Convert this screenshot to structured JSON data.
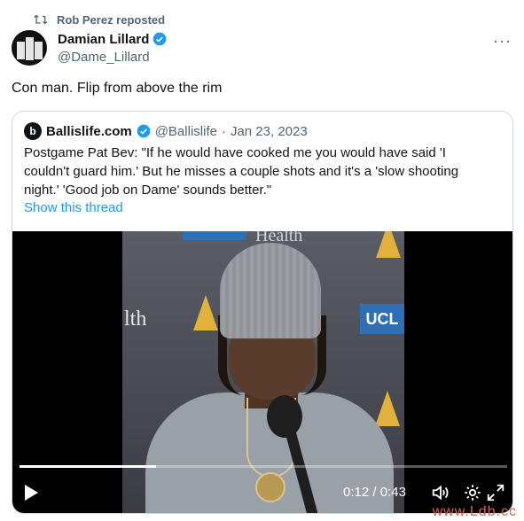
{
  "repost": {
    "icon": "repost-icon",
    "text": "Rob Perez reposted"
  },
  "author": {
    "name": "Damian Lillard",
    "handle": "@Dame_Lillard",
    "verified": true
  },
  "more_menu": {
    "label": "···",
    "icon": "more-icon"
  },
  "tweet": {
    "text": "Con man. Flip from above the rim"
  },
  "quote": {
    "logo": "b",
    "name": "Ballislife.com",
    "handle": "@Ballislife",
    "separator": "·",
    "date": "Jan 23, 2023",
    "text": "Postgame Pat Bev: \"If he would have cooked me you would have said 'I couldn't guard him.' But he misses a couple shots and it's a 'slow shooting night.' 'Good job on Dame' sounds better.\"",
    "show_thread": "Show this thread"
  },
  "video": {
    "backdrop_texts": {
      "ucla": "UCL",
      "health": "Health",
      "lth": "lth"
    },
    "current_time": "0:12",
    "time_separator": "/",
    "duration": "0:43",
    "progress_fraction": 0.28
  },
  "watermark": "www.Ldb.cc",
  "colors": {
    "accent": "#1d9bf0",
    "text": "#0f1419",
    "muted": "#536471",
    "border": "#cfd9de"
  }
}
